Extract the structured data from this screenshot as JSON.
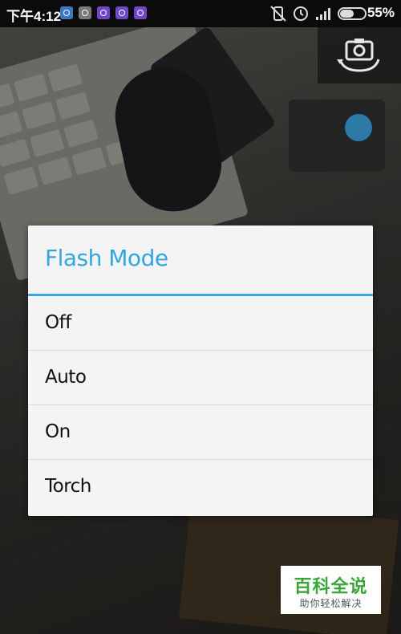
{
  "status_bar": {
    "time": "下午4:12",
    "battery_percent": "55%",
    "notification_icons": [
      "gallery-icon",
      "tooth-icon",
      "app-icon",
      "app-icon",
      "app-icon"
    ],
    "status_icons": [
      "vibrate-icon",
      "alarm-icon",
      "signal-icon",
      "battery-icon"
    ]
  },
  "camera": {
    "switch_camera_icon": "switch-camera-icon"
  },
  "dialog": {
    "title": "Flash Mode",
    "options": [
      {
        "label": "Off"
      },
      {
        "label": "Auto"
      },
      {
        "label": "On"
      },
      {
        "label": "Torch"
      }
    ]
  },
  "watermark": {
    "main": "百科全说",
    "sub": "助你轻松解决"
  },
  "colors": {
    "accent": "#33a6df",
    "dialog_bg": "#f4f4f4",
    "divider": "#d6d6d6"
  }
}
